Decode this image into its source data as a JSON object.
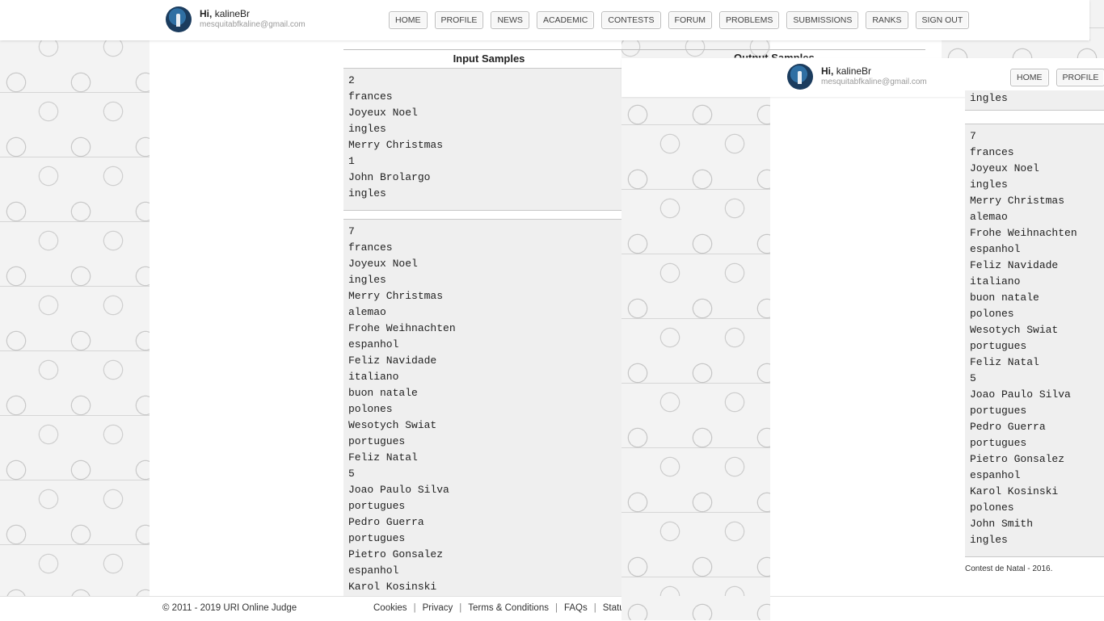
{
  "header": {
    "greeting_prefix": "Hi,",
    "username": "kalineBr",
    "email": "mesquitabfkaline@gmail.com",
    "nav": [
      "HOME",
      "PROFILE",
      "NEWS",
      "ACADEMIC",
      "CONTESTS",
      "FORUM",
      "PROBLEMS",
      "SUBMISSIONS",
      "RANKS",
      "SIGN OUT"
    ]
  },
  "overlay_header": {
    "greeting_prefix": "Hi,",
    "username": "kalineBr",
    "email": "mesquitabfkaline@gmail.com",
    "nav": [
      "HOME",
      "PROFILE"
    ]
  },
  "samples": {
    "input_title": "Input Samples",
    "output_title_partial": "Output Samples",
    "input_1": [
      "2",
      "frances",
      "Joyeux Noel",
      "ingles",
      "Merry Christmas",
      "1",
      "John Brolargo",
      "ingles"
    ],
    "input_2": [
      "7",
      "frances",
      "Joyeux Noel",
      "ingles",
      "Merry Christmas",
      "alemao",
      "Frohe Weihnachten",
      "espanhol",
      "Feliz Navidade",
      "italiano",
      "buon natale",
      "polones",
      "Wesotych Swiat",
      "portugues",
      "Feliz Natal",
      "5",
      "Joao Paulo Silva",
      "portugues",
      "Pedro Guerra",
      "portugues",
      "Pietro Gonsalez",
      "espanhol",
      "Karol Kosinski"
    ],
    "right_partial_top": "ingles",
    "right_input_2": [
      "7",
      "frances",
      "Joyeux Noel",
      "ingles",
      "Merry Christmas",
      "alemao",
      "Frohe Weihnachten",
      "espanhol",
      "Feliz Navidade",
      "italiano",
      "buon natale",
      "polones",
      "Wesotych Swiat",
      "portugues",
      "Feliz Natal",
      "5",
      "Joao Paulo Silva",
      "portugues",
      "Pedro Guerra",
      "portugues",
      "Pietro Gonsalez",
      "espanhol",
      "Karol Kosinski",
      "polones",
      "John Smith",
      "ingles"
    ]
  },
  "contest_note": "Contest de Natal - 2016.",
  "footer": {
    "copyright": "© 2011 - 2019 URI Online Judge",
    "links": [
      "Cookies",
      "Privacy",
      "Terms & Conditions",
      "FAQs",
      "Status"
    ]
  }
}
